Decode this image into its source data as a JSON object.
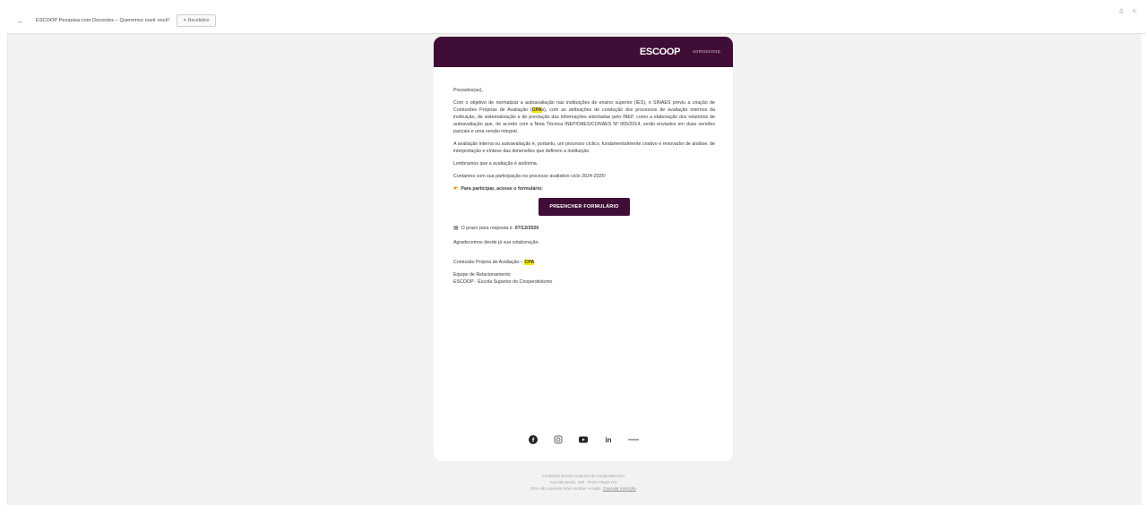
{
  "topbar": {
    "back_icon": "back-arrow-icon",
    "subject": "ESCOOP Pesquisa com Docentes – Queremos ouvir você!",
    "tag": "Recebidos"
  },
  "brand": {
    "logo": "ESCOOP",
    "sub": "somoscoop"
  },
  "email": {
    "greeting": "Prezados(as),",
    "para1_a": "Com o objetivo de normatizar a autoavaliação nas instituições de ensino superior (IES), o SINAES previu a criação de Comissões Próprias de Avaliação (",
    "para1_hl": "CPA",
    "para1_b": "s), com as atribuições de condução dos processos de avaliação internos da instituição, de sistematização e de prestação das informações solicitadas pelo INEP, como a elaboração dos relatórios de autoavaliação que, de acordo com a Nota Técnica INEP/DAES/CONAES Nº 065/2014, serão enviados em duas versões parciais e uma versão integral.",
    "para2": "A avaliação interna ou autoavaliação é, portanto, um processo cíclico, fundamentalmente criativo e renovador de análise, de interpretação e síntese das dimensões que definem a instituição.",
    "para3": "Lembramos que a avaliação é anônima.",
    "para4": "Contamos com sua participação no processo avaliativo ciclo 2024-2026!",
    "cta_intro": "Para participar, acesse o formulário:",
    "cta_label": "PREENCHER FORMULÁRIO",
    "deadline_text": "O prazo para resposta é ",
    "deadline_date": "07/12/2026",
    "thanks": "Agradecemos desde já sua colaboração.",
    "sign_a": "Comissão Própria de Avaliação – ",
    "sign_hl": "CPA",
    "team": "Equipe de Relacionamento",
    "org": "ESCOOP - Escola Superior do Cooperativismo"
  },
  "social": [
    "facebook-icon",
    "instagram-icon",
    "youtube-icon",
    "linkedin-icon",
    "flickr-icon"
  ],
  "footer": {
    "line1": "Fundação Escola Superior do Cooperativismo",
    "line2": "Avenida Brasil, 160 · Porto Alegre RS",
    "line3_a": "Este não queiram mais receber e-mails. ",
    "line3_link": "Cancelar inscrição"
  },
  "colors": {
    "brand": "#3f0d35",
    "highlight": "#f7e600"
  }
}
